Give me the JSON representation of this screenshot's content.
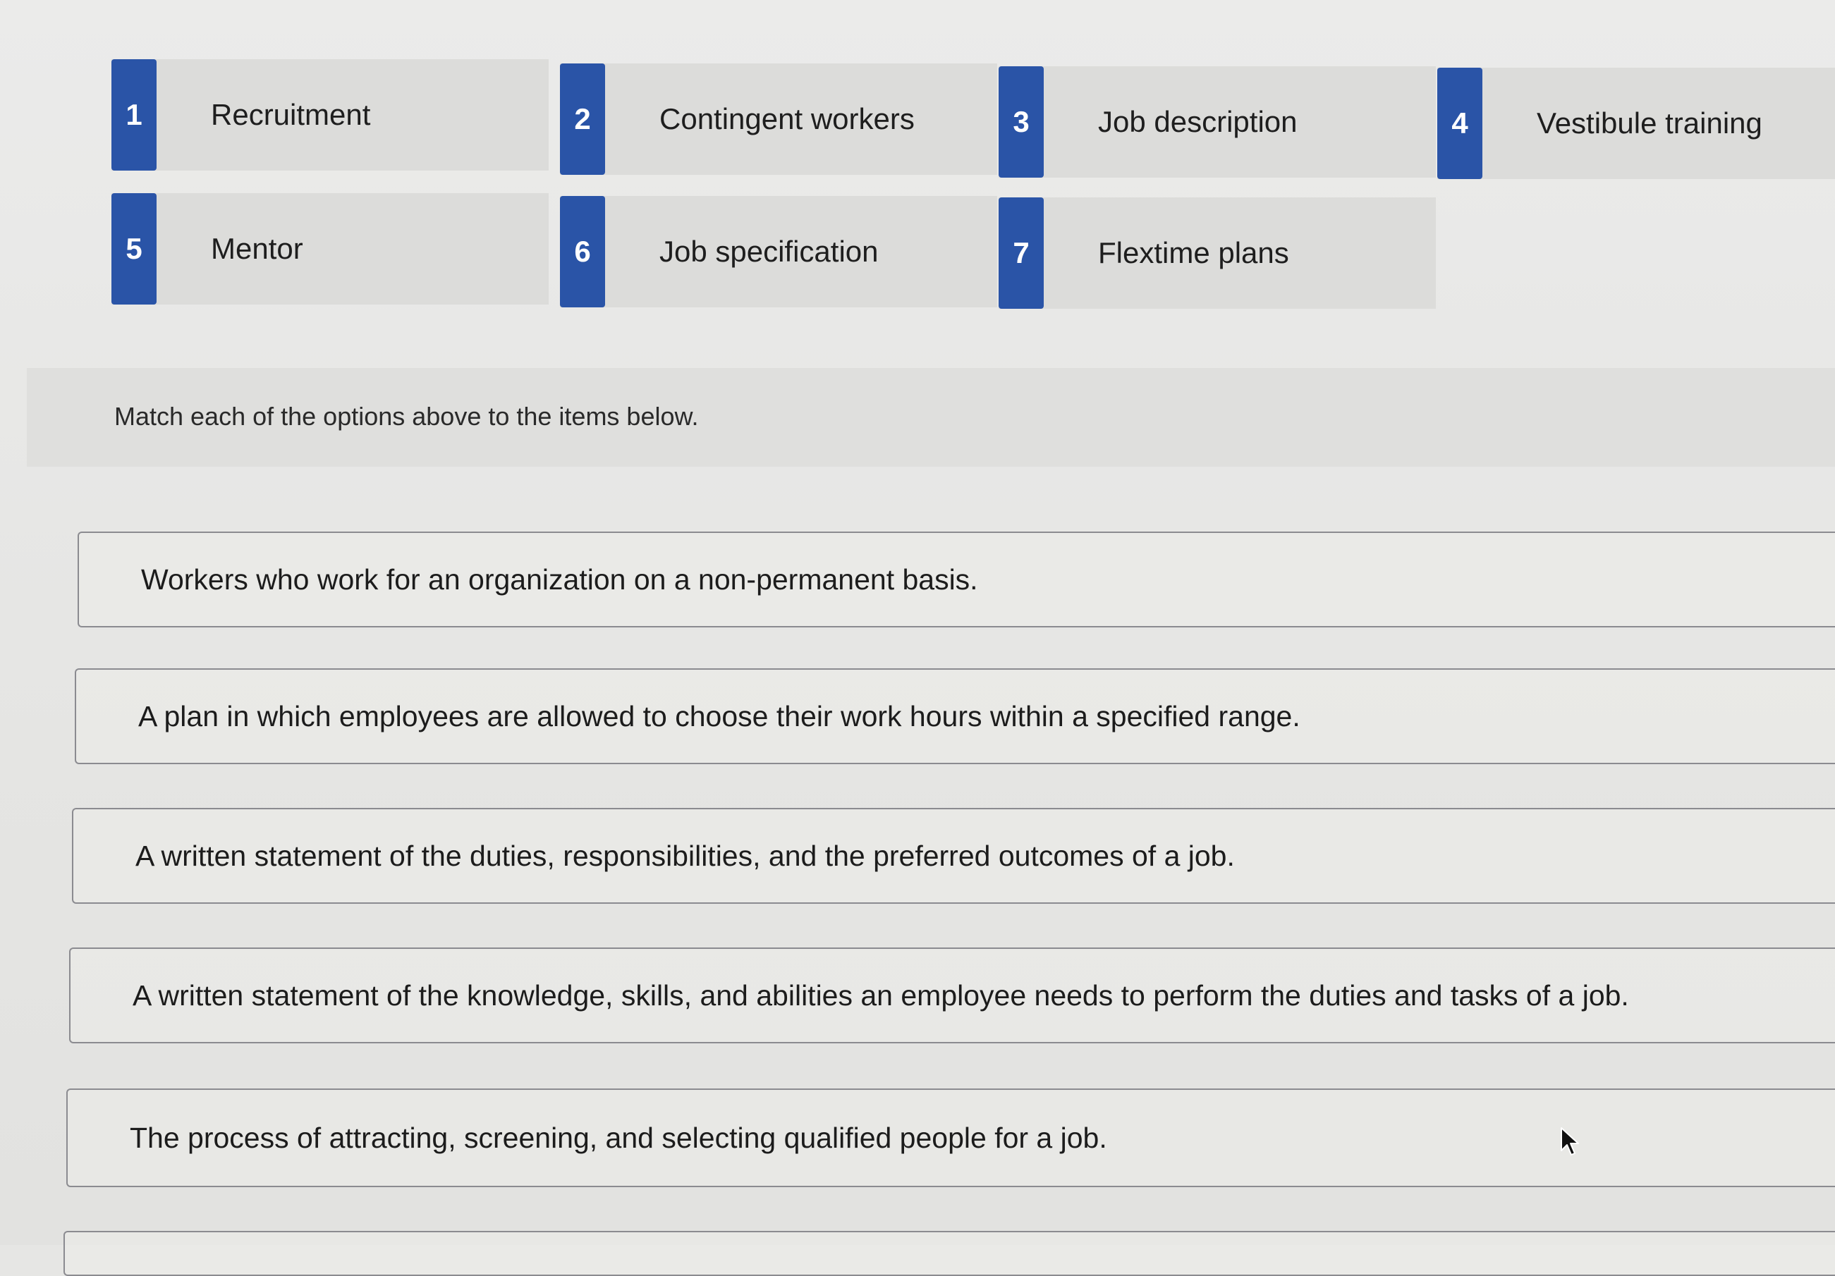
{
  "options": [
    {
      "number": "1",
      "label": "Recruitment"
    },
    {
      "number": "2",
      "label": "Contingent workers"
    },
    {
      "number": "3",
      "label": "Job description"
    },
    {
      "number": "4",
      "label": "Vestibule training"
    },
    {
      "number": "5",
      "label": "Mentor"
    },
    {
      "number": "6",
      "label": "Job specification"
    },
    {
      "number": "7",
      "label": "Flextime plans"
    }
  ],
  "instruction": "Match each of the options above to the items below.",
  "items": [
    {
      "text": "Workers who work for an organization on a non-permanent basis."
    },
    {
      "text": "A plan in which employees are allowed to choose their work hours within a specified range."
    },
    {
      "text": "A written statement of the duties, responsibilities, and the preferred outcomes of a job."
    },
    {
      "text": "A written statement of the knowledge, skills, and abilities an employee needs to perform the duties and tasks of a job."
    },
    {
      "text": "The process of attracting, screening, and selecting qualified people for a job."
    }
  ],
  "colors": {
    "badge": "#2a54a7",
    "tile": "#dcdcda",
    "border": "#8b8b90"
  },
  "icons": {
    "cursor": "mouse-pointer-icon"
  }
}
